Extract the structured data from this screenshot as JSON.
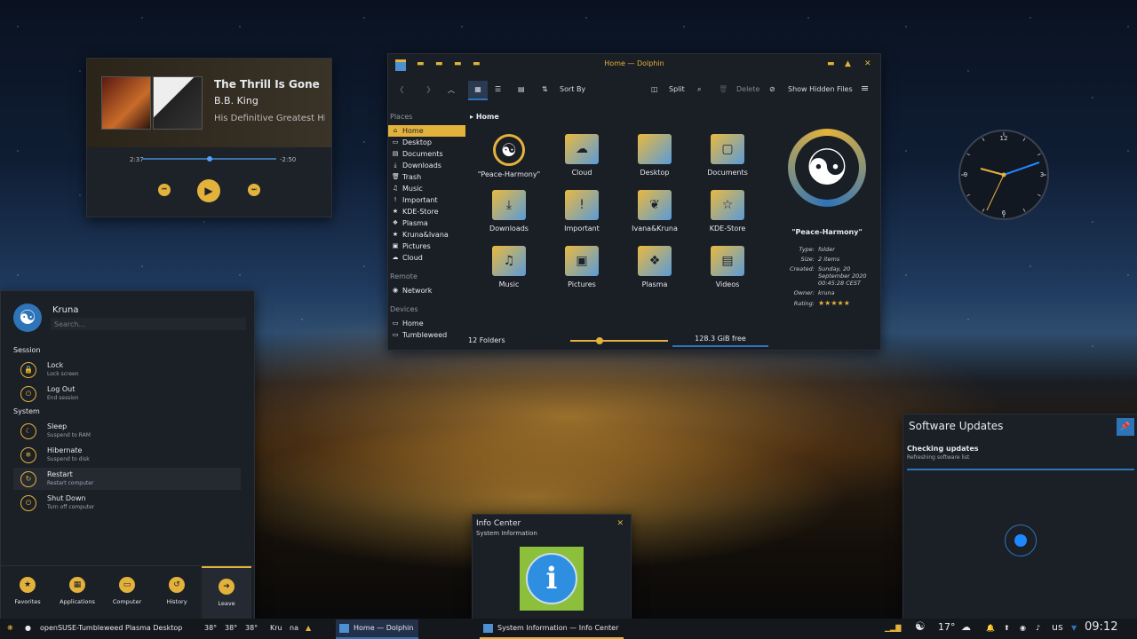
{
  "media": {
    "title": "The Thrill Is Gone",
    "artist": "B.B. King",
    "album": "His Definitive Greatest Hi...",
    "elapsed": "2:37",
    "remaining": "-2:50",
    "progress": 0.5
  },
  "dolphin": {
    "window_title": "Home — Dolphin",
    "toolbar": {
      "sort_by": "Sort By",
      "split": "Split",
      "delete": "Delete",
      "hidden": "Show Hidden Files"
    },
    "places_header": "Places",
    "places": [
      {
        "label": "Home",
        "icon": "home-icon"
      },
      {
        "label": "Desktop",
        "icon": "desktop-icon"
      },
      {
        "label": "Documents",
        "icon": "document-icon"
      },
      {
        "label": "Downloads",
        "icon": "download-icon"
      },
      {
        "label": "Trash",
        "icon": "trash-icon"
      },
      {
        "label": "Music",
        "icon": "music-icon"
      },
      {
        "label": "Important",
        "icon": "important-icon"
      },
      {
        "label": "KDE-Store",
        "icon": "star-icon"
      },
      {
        "label": "Plasma",
        "icon": "plasma-icon"
      },
      {
        "label": "Kruna&Ivana",
        "icon": "star-icon"
      },
      {
        "label": "Pictures",
        "icon": "picture-icon"
      },
      {
        "label": "Cloud",
        "icon": "cloud-icon"
      }
    ],
    "remote_header": "Remote",
    "remote": [
      {
        "label": "Network",
        "icon": "network-icon"
      }
    ],
    "devices_header": "Devices",
    "devices": [
      {
        "label": "Home",
        "icon": "drive-icon"
      },
      {
        "label": "Tumbleweed",
        "icon": "drive-icon"
      }
    ],
    "breadcrumb": "Home",
    "files": [
      {
        "label": "\"Peace-Harmony\"",
        "glyph": "☯"
      },
      {
        "label": "Cloud",
        "glyph": "☁"
      },
      {
        "label": "Desktop",
        "glyph": ""
      },
      {
        "label": "Documents",
        "glyph": "▢"
      },
      {
        "label": "Downloads",
        "glyph": "⤓"
      },
      {
        "label": "Important",
        "glyph": "!"
      },
      {
        "label": "Ivana&Kruna",
        "glyph": "❦"
      },
      {
        "label": "KDE-Store",
        "glyph": "☆"
      },
      {
        "label": "Music",
        "glyph": "♫"
      },
      {
        "label": "Pictures",
        "glyph": "▣"
      },
      {
        "label": "Plasma",
        "glyph": "❖"
      },
      {
        "label": "Videos",
        "glyph": "▤"
      }
    ],
    "preview": {
      "name": "\"Peace-Harmony\"",
      "type_label": "Type:",
      "type": "folder",
      "size_label": "Size:",
      "size": "2 items",
      "created_label": "Created:",
      "created": "Sunday, 20 September 2020 00:45:28 CEST",
      "owner_label": "Owner:",
      "owner": "kruna",
      "rating_label": "Rating:",
      "rating": "★★★★★"
    },
    "status_count": "12 Folders",
    "status_free": "128.3 GiB free",
    "zoom": 0.3
  },
  "launcher": {
    "user": "Kruna",
    "search_placeholder": "Search...",
    "session_header": "Session",
    "system_header": "System",
    "session": [
      {
        "title": "Lock",
        "subtitle": "Lock screen",
        "glyph": "🔒"
      },
      {
        "title": "Log Out",
        "subtitle": "End session",
        "glyph": "⏻"
      }
    ],
    "system": [
      {
        "title": "Sleep",
        "subtitle": "Suspend to RAM",
        "glyph": "☾"
      },
      {
        "title": "Hibernate",
        "subtitle": "Suspend to disk",
        "glyph": "❄"
      },
      {
        "title": "Restart",
        "subtitle": "Restart computer",
        "glyph": "↻"
      },
      {
        "title": "Shut Down",
        "subtitle": "Turn off computer",
        "glyph": "⏻"
      }
    ],
    "tabs": [
      {
        "label": "Favorites",
        "glyph": "★"
      },
      {
        "label": "Applications",
        "glyph": "▦"
      },
      {
        "label": "Computer",
        "glyph": "▭"
      },
      {
        "label": "History",
        "glyph": "↺"
      },
      {
        "label": "Leave",
        "glyph": "➔"
      }
    ]
  },
  "updates": {
    "title": "Software Updates",
    "status": "Checking updates",
    "detail": "Refreshing software list"
  },
  "info": {
    "title": "Info Center",
    "subtitle": "System Information"
  },
  "clock": {
    "hours": [
      12,
      3,
      6,
      9
    ]
  },
  "taskbar": {
    "distro": "openSUSE-Tumbleweed",
    "desktop": "Plasma Desktop",
    "temps": [
      "38°",
      "38°",
      "38°"
    ],
    "short1": "Kru",
    "short2": "na",
    "tasks": [
      "Home — Dolphin",
      "System Information — Info Center"
    ],
    "weather": "17°",
    "layout": "us",
    "time": "09:12"
  },
  "colors": {
    "accent": "#e3b23c",
    "blue": "#2e74b8",
    "panel": "#1d2128"
  }
}
